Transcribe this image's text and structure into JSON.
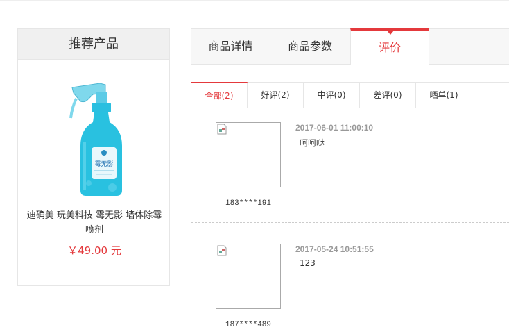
{
  "recommend": {
    "title": "推荐产品",
    "product_name": "迪确美 玩美科技 霉无影 墙体除霉喷剂",
    "price": "￥49.00 元",
    "bottle_label": "霉无影"
  },
  "tabs": [
    {
      "label": "商品详情",
      "active": false
    },
    {
      "label": "商品参数",
      "active": false
    },
    {
      "label": "评价",
      "active": true
    }
  ],
  "filters": [
    {
      "label": "全部(2)",
      "active": true
    },
    {
      "label": "好评(2)",
      "active": false
    },
    {
      "label": "中评(0)",
      "active": false
    },
    {
      "label": "差评(0)",
      "active": false
    },
    {
      "label": "晒单(1)",
      "active": false
    }
  ],
  "reviews": [
    {
      "date": "2017-06-01 11:00:10",
      "text": "呵呵哒",
      "user": "183****191"
    },
    {
      "date": "2017-05-24 10:51:55",
      "text": "123",
      "user": "187****489"
    }
  ],
  "colors": {
    "accent": "#e4393c",
    "bottle": "#29c1e0"
  }
}
